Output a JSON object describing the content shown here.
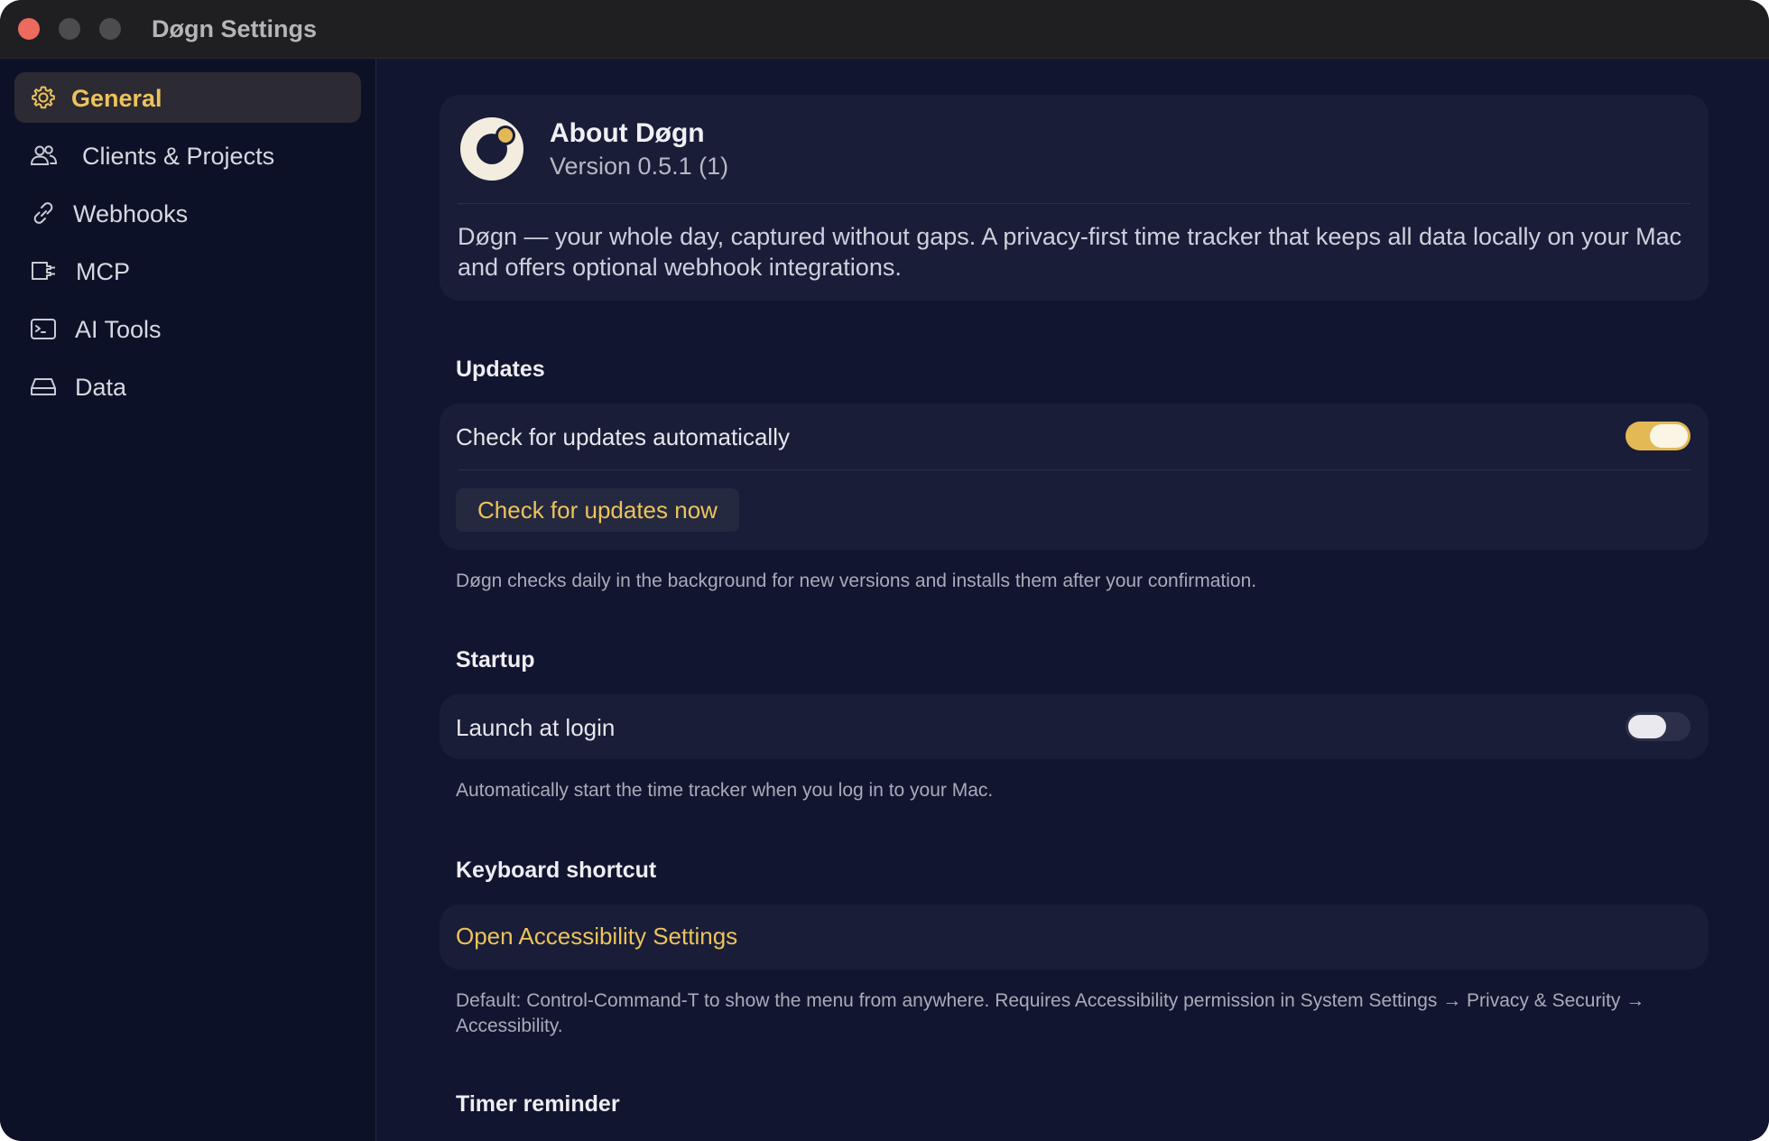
{
  "window": {
    "title": "Døgn Settings"
  },
  "sidebar": {
    "items": [
      {
        "label": "General",
        "icon": "gear-icon",
        "active": true
      },
      {
        "label": "Clients & Projects",
        "icon": "people-icon",
        "active": false
      },
      {
        "label": "Webhooks",
        "icon": "link-icon",
        "active": false
      },
      {
        "label": "MCP",
        "icon": "plug-icon",
        "active": false
      },
      {
        "label": "AI Tools",
        "icon": "terminal-icon",
        "active": false
      },
      {
        "label": "Data",
        "icon": "drive-icon",
        "active": false
      }
    ]
  },
  "about": {
    "title": "About Døgn",
    "version": "Version 0.5.1 (1)",
    "description": "Døgn — your whole day, captured without gaps. A privacy-first time tracker that keeps all data locally on your Mac and offers optional webhook integrations."
  },
  "updates": {
    "title": "Updates",
    "auto_label": "Check for updates automatically",
    "auto_enabled": true,
    "check_now_label": "Check for updates now",
    "help": "Døgn checks daily in the background for new versions and installs them after your confirmation."
  },
  "startup": {
    "title": "Startup",
    "launch_label": "Launch at login",
    "launch_enabled": false,
    "help": "Automatically start the time tracker when you log in to your Mac."
  },
  "shortcut": {
    "title": "Keyboard shortcut",
    "open_accessibility_label": "Open Accessibility Settings",
    "help": "Default: Control-Command-T to show the menu from anywhere. Requires Accessibility permission in System Settings → Privacy & Security → Accessibility."
  },
  "timer_reminder": {
    "title": "Timer reminder"
  },
  "colors": {
    "accent": "#ecc35c",
    "background": "#111530",
    "sidebar": "#0d1128",
    "card": "#191d38"
  }
}
